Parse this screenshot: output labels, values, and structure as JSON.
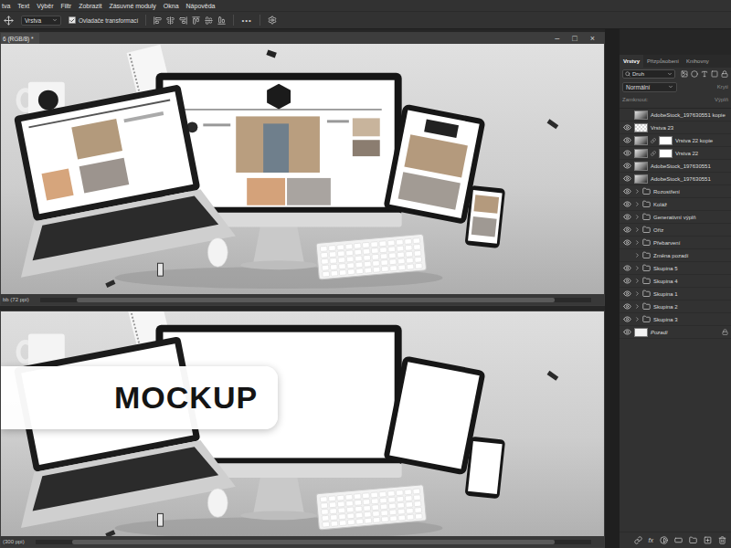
{
  "menu_bar": {
    "items": [
      "tva",
      "Text",
      "Výběr",
      "Filtr",
      "Zobrazit",
      "Zásuvné moduly",
      "Okna",
      "Nápověda"
    ]
  },
  "options_bar": {
    "auto_select": "Vrstva",
    "transform_controls": {
      "label": "Ovladače transformací",
      "checked": true
    },
    "more": "•••"
  },
  "document_top": {
    "title": "6 (RGB/8) *",
    "controls": [
      "–",
      "□",
      "×"
    ],
    "status": "bb (72 ppi)",
    "screens_filled": true
  },
  "document_bottom": {
    "status": "(300 ppi)",
    "screens_filled": false,
    "overlay_label": "MOCKUP"
  },
  "layers_panel": {
    "tabs": [
      {
        "label": "Vrstvy",
        "selected": true
      },
      {
        "label": "Přizpůsobení",
        "selected": false
      },
      {
        "label": "Knihovny",
        "selected": false
      }
    ],
    "filter": "Druh",
    "blend_mode": "Normální",
    "opacity_label": "Krytí",
    "lock_label": "Zamknout:",
    "fill_label": "Výplň",
    "layers": [
      {
        "name": "AdobeStock_197630551 kopie",
        "kind": "image",
        "visible": false,
        "selected": false
      },
      {
        "name": "Vrstva 23",
        "kind": "empty",
        "visible": true,
        "selected": false
      },
      {
        "name": "Vrstva 22 kopie",
        "kind": "masked",
        "visible": true,
        "selected": false
      },
      {
        "name": "Vrstva 22",
        "kind": "masked",
        "visible": true,
        "selected": false
      },
      {
        "name": "AdobeStock_197630551",
        "kind": "image",
        "visible": true,
        "selected": false
      },
      {
        "name": "AdobeStock_197630551",
        "kind": "image",
        "visible": true,
        "selected": false
      },
      {
        "name": "Rozostření",
        "kind": "group",
        "visible": true,
        "selected": false,
        "expanded": false
      },
      {
        "name": "Koláž",
        "kind": "group",
        "visible": true,
        "selected": false,
        "expanded": false
      },
      {
        "name": "Generativní výplň",
        "kind": "group",
        "visible": true,
        "selected": false,
        "expanded": false
      },
      {
        "name": "Oříz",
        "kind": "group",
        "visible": true,
        "selected": false,
        "expanded": false
      },
      {
        "name": "Přebarvení",
        "kind": "group",
        "visible": true,
        "selected": false,
        "expanded": false
      },
      {
        "name": "Změna pozadí",
        "kind": "group",
        "visible": false,
        "selected": false,
        "expanded": false
      },
      {
        "name": "Skupina 5",
        "kind": "group",
        "visible": true,
        "selected": false,
        "expanded": false
      },
      {
        "name": "Skupina 4",
        "kind": "group",
        "visible": true,
        "selected": false,
        "expanded": false
      },
      {
        "name": "Skupina 1",
        "kind": "group",
        "visible": true,
        "selected": false,
        "expanded": false
      },
      {
        "name": "Skupina 2",
        "kind": "group",
        "visible": true,
        "selected": false,
        "expanded": false
      },
      {
        "name": "Skupina 3",
        "kind": "group",
        "visible": true,
        "selected": false,
        "expanded": false
      },
      {
        "name": "Pozadí",
        "kind": "background",
        "visible": true,
        "selected": false
      }
    ],
    "bottom_toolbar": {
      "effects": "fx"
    }
  }
}
